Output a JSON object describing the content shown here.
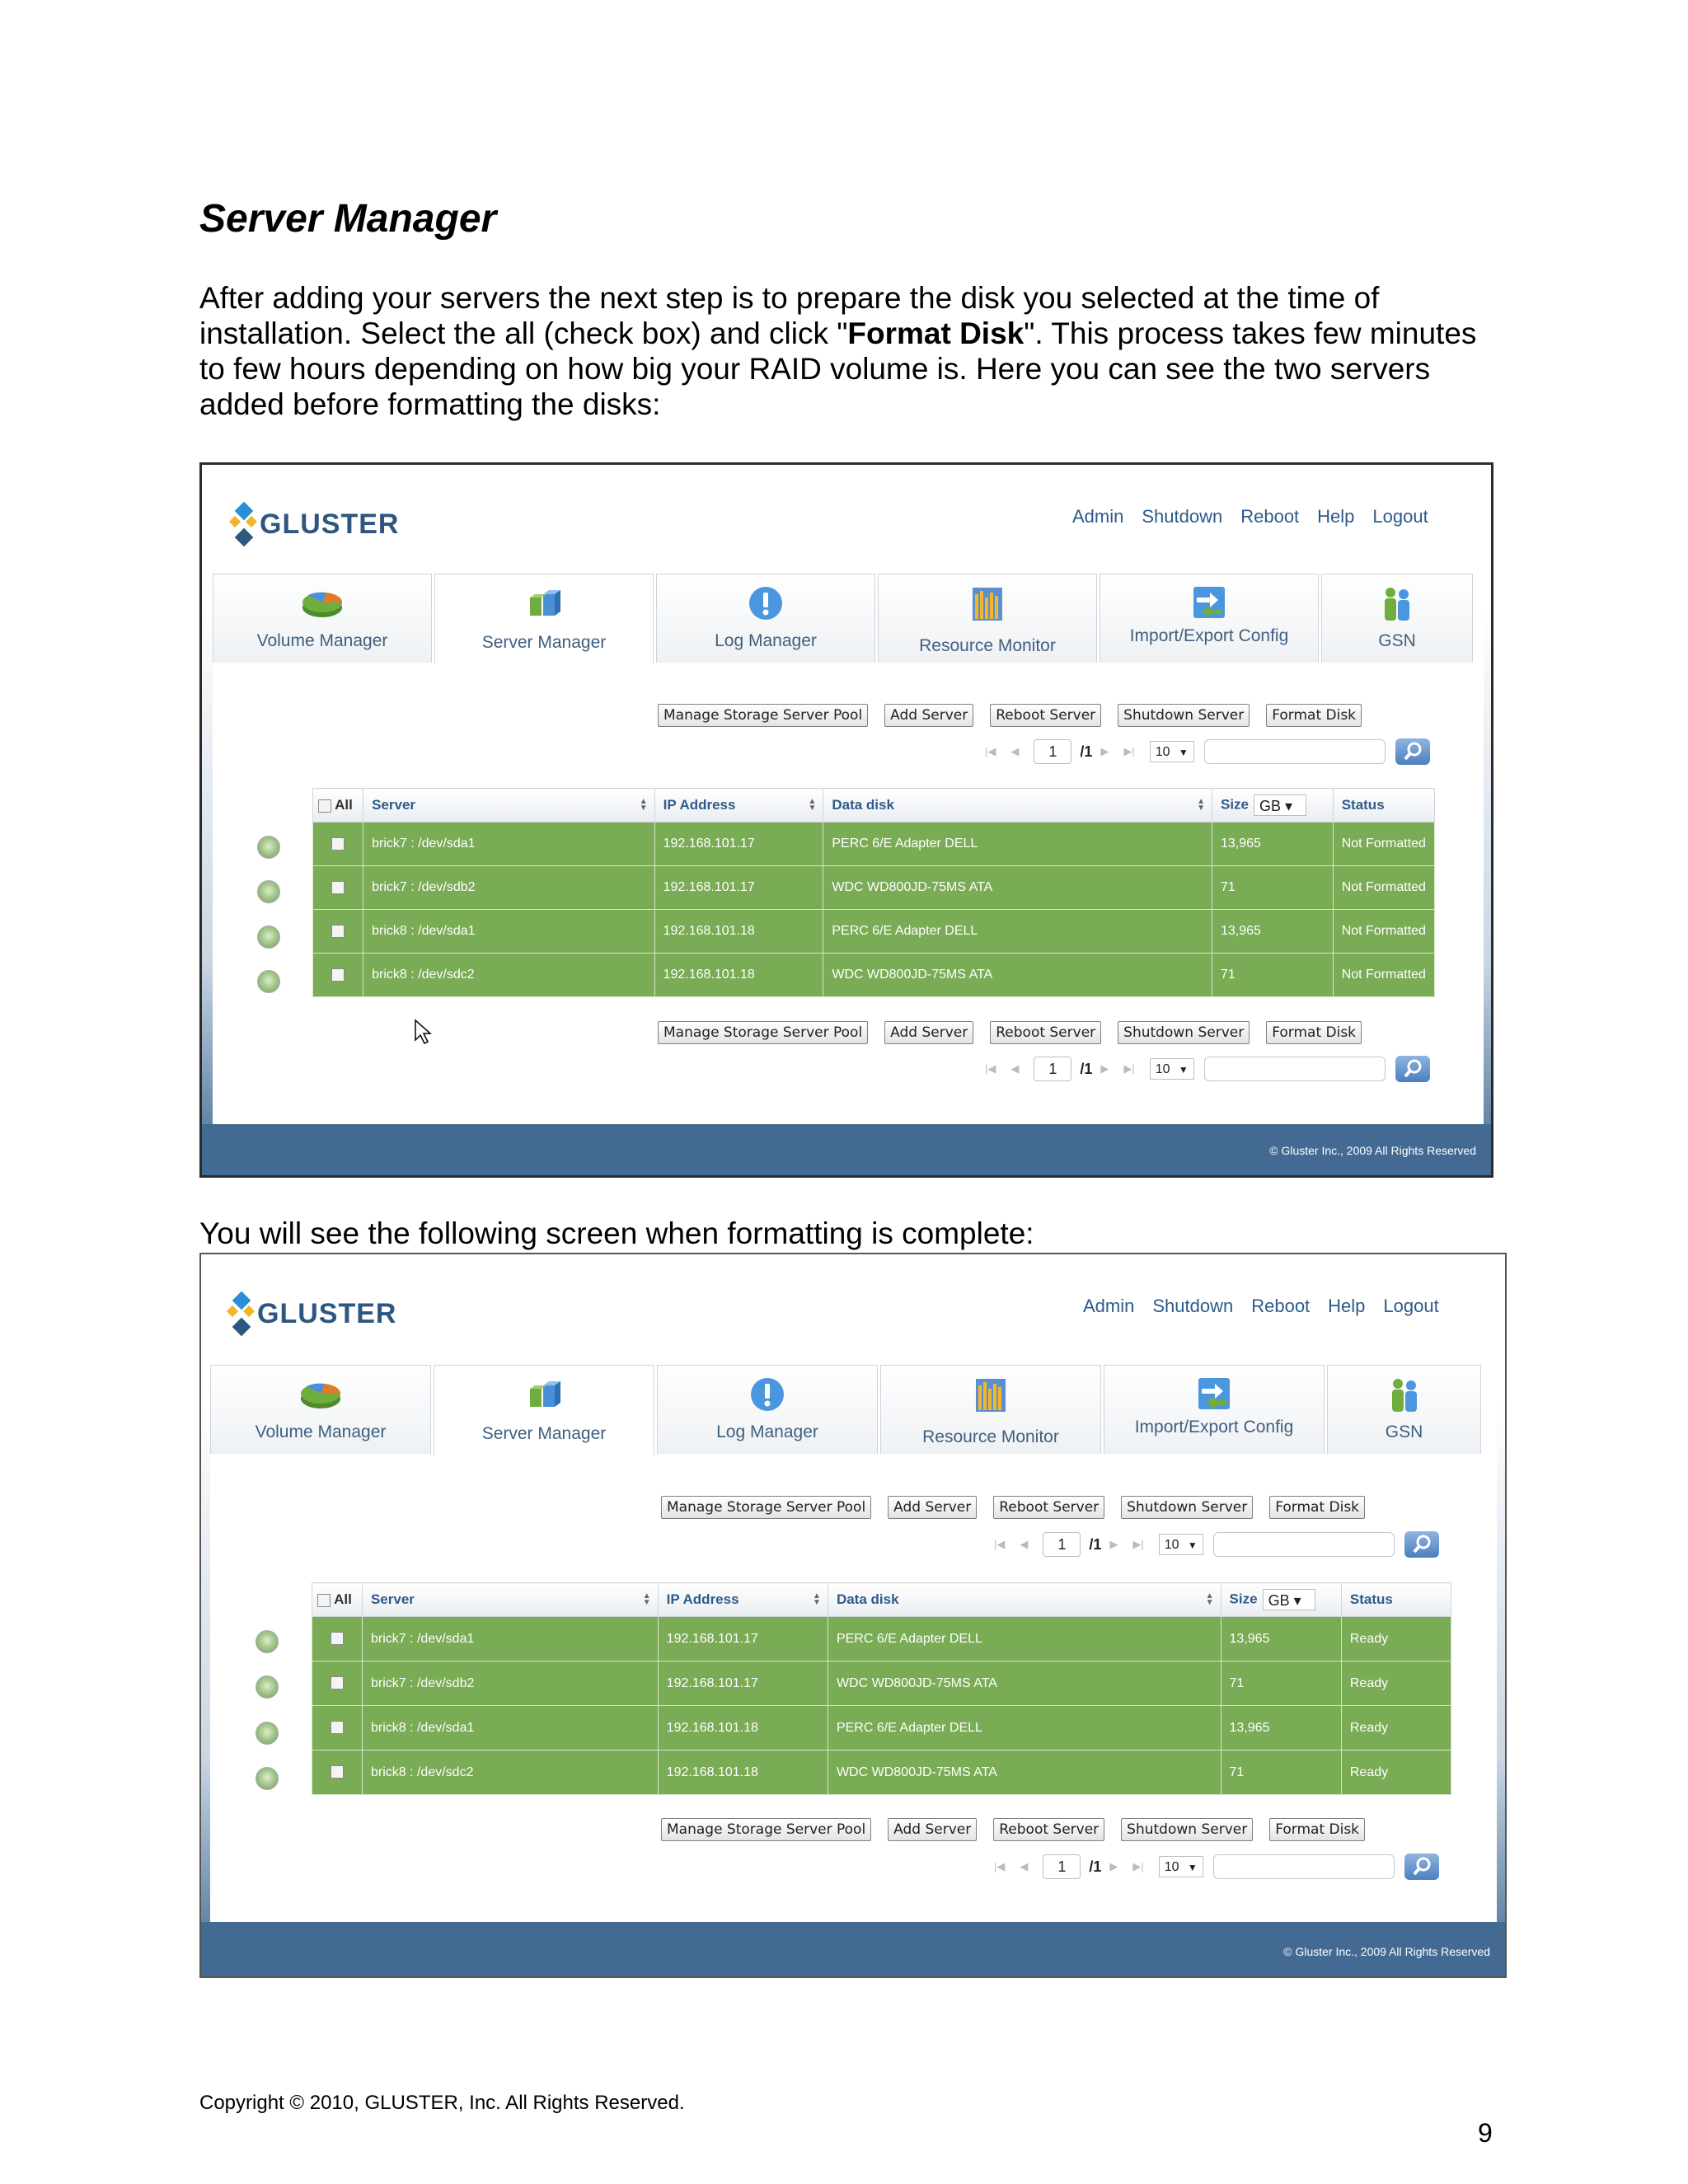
{
  "document": {
    "title": "Server Manager",
    "intro_part1": "After adding your servers the next step is to prepare the disk you selected at the time of installation.  Select the all (check box) and click \"",
    "intro_bold": "Format Disk",
    "intro_part2": "\".  This process takes few minutes to few hours depending on how big your RAID volume is.  Here you can see the two servers added before formatting the disks:",
    "caption": "You will see the following screen when formatting is complete:",
    "copyright": "Copyright © 2010, GLUSTER, Inc. All Rights Reserved.",
    "page_number": "9"
  },
  "app": {
    "logo_text": "GLUSTER",
    "topnav": [
      "Admin",
      "Shutdown",
      "Reboot",
      "Help",
      "Logout"
    ],
    "tabs": [
      "Volume Manager",
      "Server Manager",
      "Log Manager",
      "Resource Monitor",
      "Import/Export Config",
      "GSN"
    ],
    "active_tab": "Server Manager",
    "buttons": [
      "Manage Storage Server Pool",
      "Add Server",
      "Reboot Server",
      "Shutdown Server",
      "Format Disk"
    ],
    "pager": {
      "page": "1",
      "of": "/1",
      "page_size": "10"
    },
    "table_headers": {
      "all": "All",
      "server": "Server",
      "ip": "IP Address",
      "disk": "Data disk",
      "size": "Size",
      "size_unit": "GB",
      "status": "Status"
    },
    "footer_copyright": "© Gluster Inc., 2009 All Rights Reserved"
  },
  "screen_before": {
    "rows": [
      {
        "server": "brick7 : /dev/sda1",
        "ip": "192.168.101.17",
        "disk": "PERC 6/E Adapter DELL",
        "size": "13,965",
        "status": "Not Formatted"
      },
      {
        "server": "brick7 : /dev/sdb2",
        "ip": "192.168.101.17",
        "disk": "WDC WD800JD-75MS ATA",
        "size": "71",
        "status": "Not Formatted"
      },
      {
        "server": "brick8 : /dev/sda1",
        "ip": "192.168.101.18",
        "disk": "PERC 6/E Adapter DELL",
        "size": "13,965",
        "status": "Not Formatted"
      },
      {
        "server": "brick8 : /dev/sdc2",
        "ip": "192.168.101.18",
        "disk": "WDC WD800JD-75MS ATA",
        "size": "71",
        "status": "Not Formatted"
      }
    ]
  },
  "screen_after": {
    "rows": [
      {
        "server": "brick7 : /dev/sda1",
        "ip": "192.168.101.17",
        "disk": "PERC 6/E Adapter DELL",
        "size": "13,965",
        "status": "Ready"
      },
      {
        "server": "brick7 : /dev/sdb2",
        "ip": "192.168.101.17",
        "disk": "WDC WD800JD-75MS ATA",
        "size": "71",
        "status": "Ready"
      },
      {
        "server": "brick8 : /dev/sda1",
        "ip": "192.168.101.18",
        "disk": "PERC 6/E Adapter DELL",
        "size": "13,965",
        "status": "Ready"
      },
      {
        "server": "brick8 : /dev/sdc2",
        "ip": "192.168.101.18",
        "disk": "WDC WD800JD-75MS ATA",
        "size": "71",
        "status": "Ready"
      }
    ]
  },
  "colors": {
    "accent": "#2d5680",
    "row_green": "#7aab55",
    "footer_blue": "#426a93"
  }
}
